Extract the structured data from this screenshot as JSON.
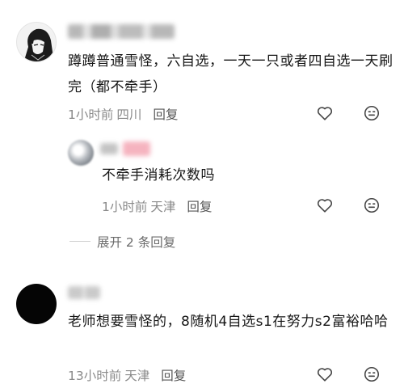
{
  "comments": [
    {
      "text": "蹲蹲普通雪怪，六自选，一天一只或者四自选一天刷完（都不牵手）",
      "time": "1小时前",
      "location": "四川",
      "reply_label": "回复",
      "replies": [
        {
          "text": "不牵手消耗次数吗",
          "time": "1小时前",
          "location": "天津",
          "reply_label": "回复"
        }
      ],
      "expand_label": "展开 2 条回复"
    },
    {
      "text": "老师想要雪怪的，8随机4自选s1在努力s2富裕哈哈",
      "time": "13小时前",
      "location": "天津",
      "reply_label": "回复"
    }
  ],
  "icons": {
    "like": "heart-outline-icon",
    "emoji": "emoji-face-icon"
  },
  "colors": {
    "text": "#161616",
    "meta": "#8a8a8a",
    "icon": "#444444"
  }
}
